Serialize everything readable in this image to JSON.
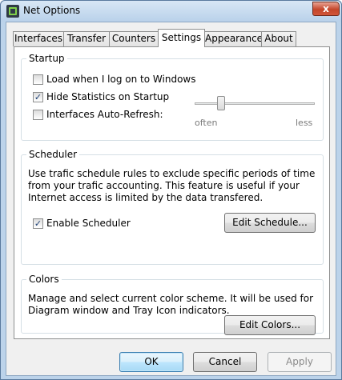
{
  "window": {
    "title": "Net Options",
    "close_glyph": "x"
  },
  "tabs": [
    {
      "label": "Interfaces"
    },
    {
      "label": "Transfer"
    },
    {
      "label": "Counters"
    },
    {
      "label": "Settings"
    },
    {
      "label": "Appearance"
    },
    {
      "label": "About"
    }
  ],
  "active_tab": "Settings",
  "startup": {
    "title": "Startup",
    "load_on_logon": {
      "label": "Load when I log on to Windows",
      "checked": false
    },
    "hide_statistics": {
      "label": "Hide Statistics on Startup",
      "checked": true
    },
    "auto_refresh": {
      "label": "Interfaces Auto-Refresh:",
      "checked": false
    },
    "refresh_slider": {
      "min_label": "often",
      "max_label": "less",
      "value_fraction": 0.2
    }
  },
  "scheduler": {
    "title": "Scheduler",
    "description": "Use trafic schedule rules to exclude specific periods of time from your trafic accounting. This feature is useful if your Internet access is limited by the data transfered.",
    "enable": {
      "label": "Enable Scheduler",
      "checked": true
    },
    "edit_button": "Edit Schedule..."
  },
  "colors": {
    "title": "Colors",
    "description": "Manage and select current color scheme. It will be used for Diagram window and Tray Icon indicators.",
    "edit_button": "Edit Colors..."
  },
  "footer": {
    "ok": "OK",
    "cancel": "Cancel",
    "apply": "Apply"
  },
  "check_glyph": "✓"
}
